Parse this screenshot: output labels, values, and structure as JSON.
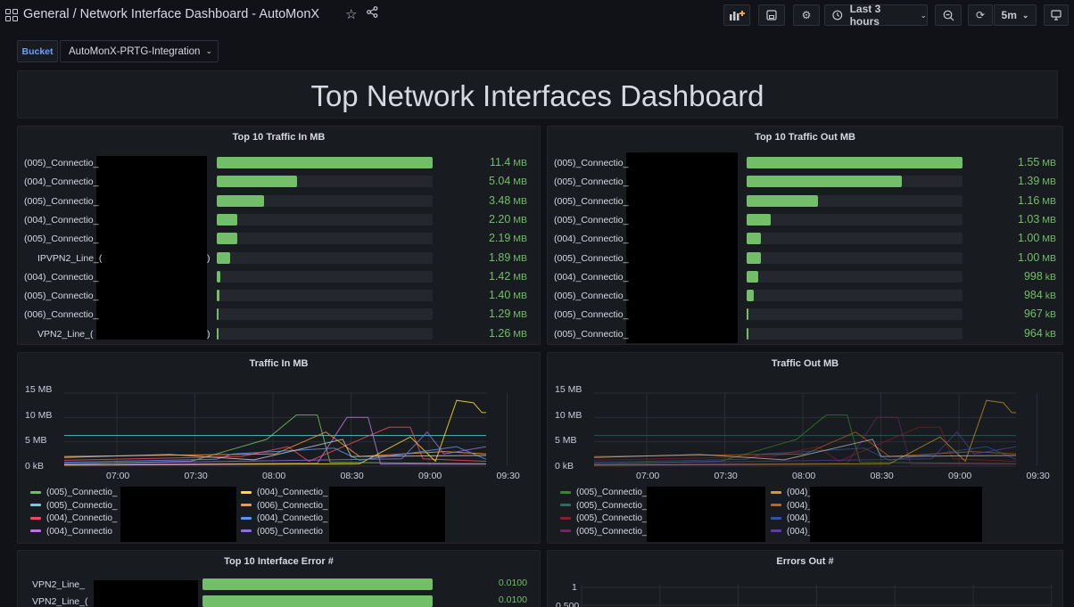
{
  "header": {
    "title": "General / Network Interface Dashboard - AutoMonX",
    "time_range": "Last 3 hours",
    "refresh": "5m"
  },
  "variables": {
    "label": "Bucket",
    "value": "AutoMonX-PRTG-Integration"
  },
  "text_panel": {
    "title": "Top Network Interfaces Dashboard"
  },
  "traffic_in_top": {
    "title": "Top 10 Traffic In MB",
    "rows": [
      {
        "label": "(005)_Connectio_",
        "value": "11.4",
        "unit": "MB",
        "fraction": 1.0
      },
      {
        "label": "(004)_Connectio_",
        "value": "5.04",
        "unit": "MB",
        "fraction": 0.37
      },
      {
        "label": "(005)_Connectio_",
        "value": "3.48",
        "unit": "MB",
        "fraction": 0.22
      },
      {
        "label": "(004)_Connectio_",
        "value": "2.20",
        "unit": "MB",
        "fraction": 0.095
      },
      {
        "label": "(005)_Connectio_",
        "value": "2.19",
        "unit": "MB",
        "fraction": 0.094
      },
      {
        "label": "IPVPN2_Line_(",
        "suffix": ")",
        "value": "1.89",
        "unit": "MB",
        "fraction": 0.064
      },
      {
        "label": "(004)_Connectio_",
        "value": "1.42",
        "unit": "MB",
        "fraction": 0.016
      },
      {
        "label": "(005)_Connectio_",
        "value": "1.40",
        "unit": "MB",
        "fraction": 0.014
      },
      {
        "label": "(006)_Connectio_",
        "value": "1.29",
        "unit": "MB",
        "fraction": 0.004
      },
      {
        "label": "VPN2_Line_(",
        "suffix": ")",
        "value": "1.26",
        "unit": "MB",
        "fraction": 0.002
      }
    ]
  },
  "traffic_out_top": {
    "title": "Top 10 Traffic Out MB",
    "rows": [
      {
        "label": "(005)_Connectio_",
        "value": "1.55",
        "unit": "MB",
        "fraction": 1.0
      },
      {
        "label": "(005)_Connectio_",
        "value": "1.39",
        "unit": "MB",
        "fraction": 0.72
      },
      {
        "label": "(005)_Connectio_",
        "value": "1.16",
        "unit": "MB",
        "fraction": 0.33
      },
      {
        "label": "(005)_Connectio_",
        "value": "1.03",
        "unit": "MB",
        "fraction": 0.11
      },
      {
        "label": "(004)_Connectio_",
        "value": "1.00",
        "unit": "MB",
        "fraction": 0.065
      },
      {
        "label": "(005)_Connectio_",
        "value": "1.00",
        "unit": "MB",
        "fraction": 0.065
      },
      {
        "label": "(004)_Connectio_",
        "value": "998",
        "unit": "kB",
        "fraction": 0.055
      },
      {
        "label": "(005)_Connectio_",
        "value": "984",
        "unit": "kB",
        "fraction": 0.035
      },
      {
        "label": "(005)_Connectio_",
        "value": "967",
        "unit": "kB",
        "fraction": 0.008
      },
      {
        "label": "(005)_Connectio_",
        "value": "964",
        "unit": "kB",
        "fraction": 0.004
      }
    ]
  },
  "chart_data": [
    {
      "type": "line",
      "title": "Traffic In MB",
      "x_ticks": [
        "07:00",
        "07:30",
        "08:00",
        "08:30",
        "09:00",
        "09:30"
      ],
      "y_ticks": [
        "15 MB",
        "10 MB",
        "5 MB",
        "0 kB"
      ],
      "ylim": [
        0,
        15
      ],
      "legend": [
        {
          "name": "(005)_Connectio_",
          "color": "#73bf69"
        },
        {
          "name": "(005)_Connectio_",
          "color": "#5cd6e6"
        },
        {
          "name": "(004)_Connectio_",
          "color": "#f2495c"
        },
        {
          "name": "(004)_Connectio",
          "color": "#b877d9"
        },
        {
          "name": "(004)_Connectio_",
          "color": "#fade2a"
        },
        {
          "name": "(006)_Connectio_",
          "color": "#ff9830"
        },
        {
          "name": "(004)_Connectio_",
          "color": "#5794f2"
        },
        {
          "name": "(005)_Connectio",
          "color": "#8f6fd7"
        }
      ]
    },
    {
      "type": "line",
      "title": "Traffic Out MB",
      "x_ticks": [
        "07:00",
        "07:30",
        "08:00",
        "08:30",
        "09:00",
        "09:30"
      ],
      "y_ticks": [
        "15 MB",
        "10 MB",
        "5 MB",
        "0 kB"
      ],
      "ylim": [
        0,
        15
      ],
      "legend": [
        {
          "name": "(005)_Connectio_",
          "color": "#37872d"
        },
        {
          "name": "(005)_Connectio_",
          "color": "#2a6e62"
        },
        {
          "name": "(005)_Connectio_",
          "color": "#8b1e26"
        },
        {
          "name": "(005)_Connectio_",
          "color": "#6b2a5e"
        },
        {
          "name": "(004)_",
          "color": "#c8a02a"
        },
        {
          "name": "(004)_",
          "color": "#c4621a"
        },
        {
          "name": "(004)_",
          "color": "#2c5aa0"
        },
        {
          "name": "(004)_",
          "color": "#5b3fa0"
        }
      ]
    }
  ],
  "error_top": {
    "title": "Top 10 Interface Error #",
    "rows": [
      {
        "label": "VPN2_Line_",
        "value": "0.0100"
      },
      {
        "label": "VPN2_Line_(",
        "value": "0.0100"
      }
    ]
  },
  "errors_out": {
    "title": "Errors Out #",
    "y_ticks": [
      "1",
      "0.500"
    ]
  }
}
